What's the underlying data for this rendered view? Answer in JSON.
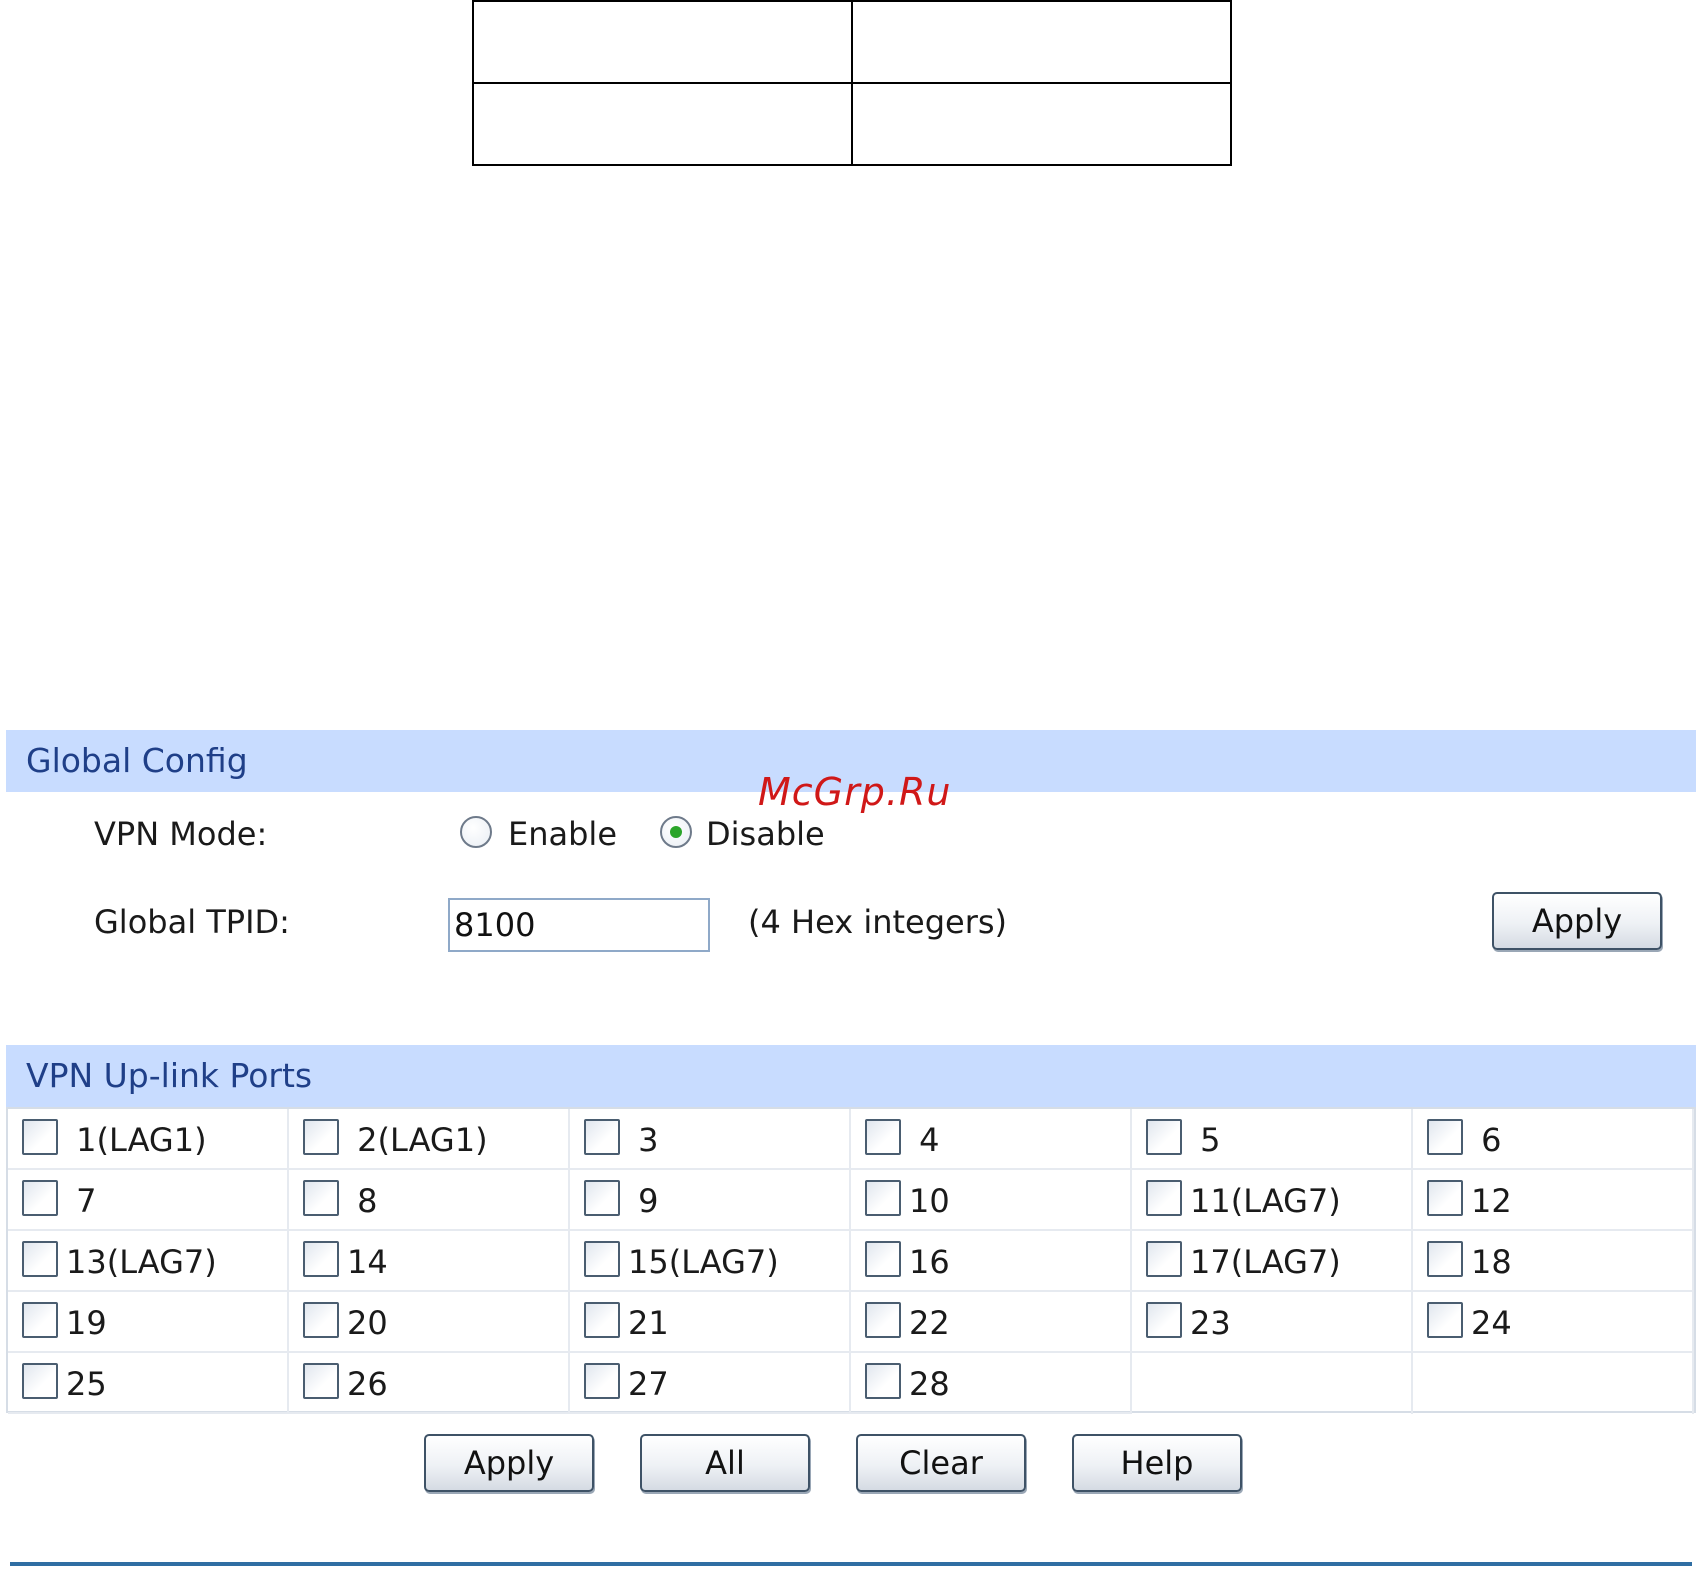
{
  "watermark": "McGrp.Ru",
  "global_config": {
    "title": "Global Config",
    "vpn_mode_label": "VPN Mode:",
    "enable_label": "Enable",
    "disable_label": "Disable",
    "vpn_mode_selected": "Disable",
    "tpid_label": "Global TPID:",
    "tpid_value": "8100",
    "tpid_hint": "(4 Hex integers)",
    "apply_label": "Apply"
  },
  "uplink_ports": {
    "title": "VPN Up-link Ports",
    "ports": [
      " 1(LAG1)",
      " 2(LAG1)",
      " 3",
      " 4",
      " 5",
      " 6",
      " 7",
      " 8",
      " 9",
      "10",
      "11(LAG7)",
      "12",
      "13(LAG7)",
      "14",
      "15(LAG7)",
      "16",
      "17(LAG7)",
      "18",
      "19",
      "20",
      "21",
      "22",
      "23",
      "24",
      "25",
      "26",
      "27",
      "28"
    ]
  },
  "buttons": {
    "apply": "Apply",
    "all": "All",
    "clear": "Clear",
    "help": "Help"
  },
  "colors": {
    "section_header_bg": "#c8dcff",
    "section_header_text": "#1f3f88",
    "watermark": "#d01818",
    "radio_selected": "#2aa52a",
    "bottom_rule": "#2f6ea3"
  }
}
